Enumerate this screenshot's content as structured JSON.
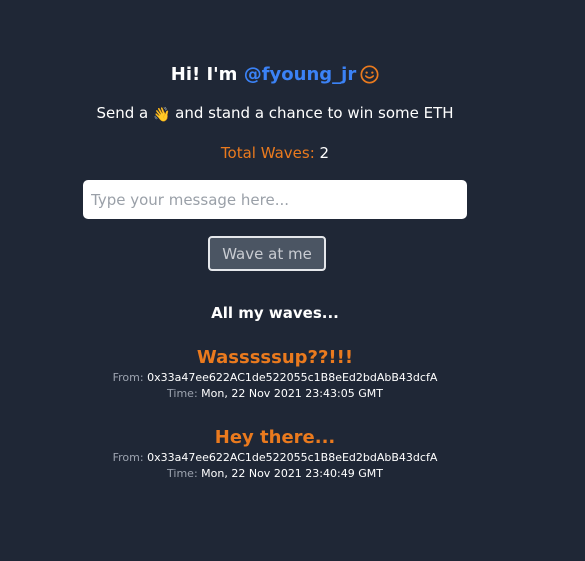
{
  "header": {
    "greeting": "Hi! I'm ",
    "handle": "@fyoung_jr"
  },
  "subtitle": {
    "before": "Send a ",
    "emoji": "👋",
    "after": " and stand a chance to win some ETH"
  },
  "total_waves": {
    "label": "Total Waves:",
    "value": "2"
  },
  "message_input": {
    "placeholder": "Type your message here...",
    "value": ""
  },
  "wave_button": {
    "label": "Wave at me"
  },
  "waves_section": {
    "title": "All my waves..."
  },
  "waves": [
    {
      "message": "Wasssssup??!!!",
      "from_label": "From:",
      "from": "0x33a47ee622AC1de522055c1B8eEd2bdAbB43dcfA",
      "time_label": "Time:",
      "time": "Mon, 22 Nov 2021 23:43:05 GMT"
    },
    {
      "message": "Hey there...",
      "from_label": "From:",
      "from": "0x33a47ee622AC1de522055c1B8eEd2bdAbB43dcfA",
      "time_label": "Time:",
      "time": "Mon, 22 Nov 2021 23:40:49 GMT"
    }
  ],
  "colors": {
    "background": "#1f2736",
    "accent_orange": "#ea7a1e",
    "handle_blue": "#3b82f6",
    "button_bg": "#4b5563"
  },
  "icons": {
    "smile": "smiling-face-icon",
    "wave": "waving-hand-emoji"
  }
}
